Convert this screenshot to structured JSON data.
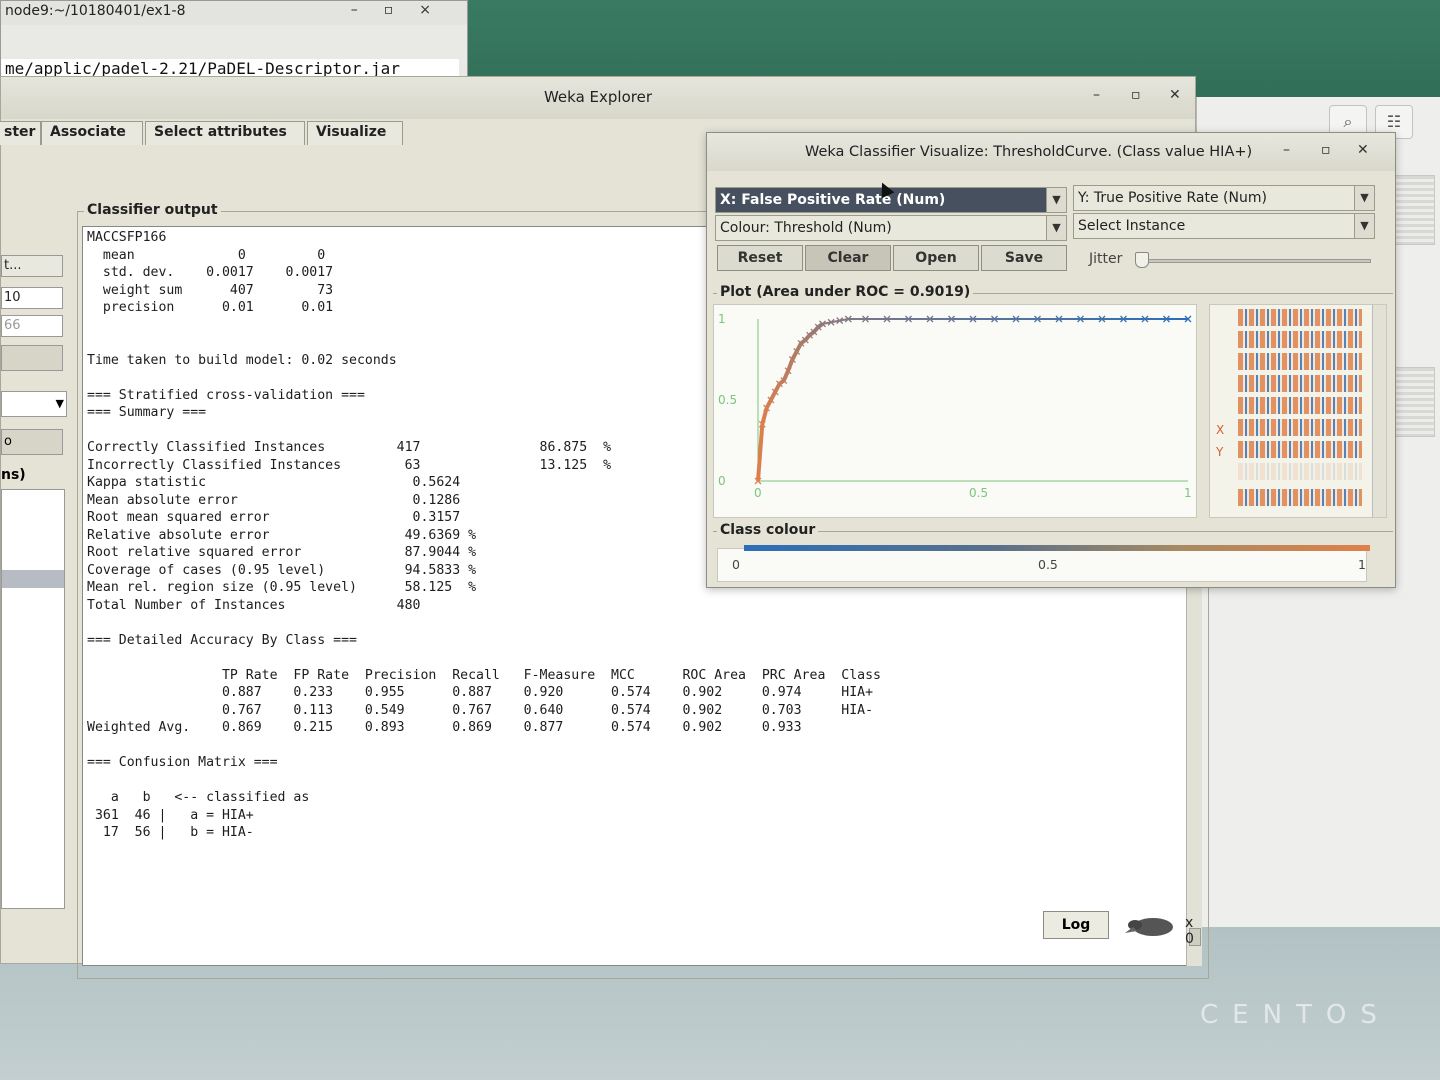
{
  "terminal": {
    "title": "node9:~/10180401/ex1-8",
    "line": "me/applic/padel-2.21/PaDEL-Descriptor.jar"
  },
  "explorer": {
    "title": "Weka Explorer",
    "tabs": [
      "ster",
      "Associate",
      "Select attributes",
      "Visualize"
    ],
    "left": {
      "field1": "t...",
      "field2": "10",
      "field3": "66",
      "label": "ns)",
      "btn": "o"
    },
    "output_label": "Classifier output",
    "output_lines": [
      "MACCSFP166",
      "  mean             0         0",
      "  std. dev.    0.0017    0.0017",
      "  weight sum      407        73",
      "  precision      0.01      0.01",
      "",
      "",
      "Time taken to build model: 0.02 seconds",
      "",
      "=== Stratified cross-validation ===",
      "=== Summary ===",
      "",
      "Correctly Classified Instances         417               86.875  %",
      "Incorrectly Classified Instances        63               13.125  %",
      "Kappa statistic                          0.5624",
      "Mean absolute error                      0.1286",
      "Root mean squared error                  0.3157",
      "Relative absolute error                 49.6369 %",
      "Root relative squared error             87.9044 %",
      "Coverage of cases (0.95 level)          94.5833 %",
      "Mean rel. region size (0.95 level)      58.125  %",
      "Total Number of Instances              480",
      "",
      "=== Detailed Accuracy By Class ===",
      "",
      "                 TP Rate  FP Rate  Precision  Recall   F-Measure  MCC      ROC Area  PRC Area  Class",
      "                 0.887    0.233    0.955      0.887    0.920      0.574    0.902     0.974     HIA+",
      "                 0.767    0.113    0.549      0.767    0.640      0.574    0.902     0.703     HIA-",
      "Weighted Avg.    0.869    0.215    0.893      0.869    0.877      0.574    0.902     0.933",
      "",
      "=== Confusion Matrix ===",
      "",
      "   a   b   <-- classified as",
      " 361  46 |   a = HIA+",
      "  17  56 |   b = HIA-"
    ],
    "log_label": "Log",
    "x_count": "x 0"
  },
  "viz": {
    "title": "Weka Classifier Visualize: ThresholdCurve. (Class value HIA+)",
    "x_combo": "X: False Positive Rate (Num)",
    "y_combo": "Y: True Positive Rate (Num)",
    "colour_combo": "Colour: Threshold (Num)",
    "select_combo": "Select Instance",
    "buttons": {
      "reset": "Reset",
      "clear": "Clear",
      "open": "Open",
      "save": "Save"
    },
    "jitter_label": "Jitter",
    "plot_label": "Plot (Area under ROC = 0.9019)",
    "class_colour_label": "Class colour",
    "colour_ticks": [
      "0",
      "0.5",
      "1"
    ],
    "attr_x": "X",
    "attr_y": "Y"
  },
  "chart_data": {
    "type": "scatter",
    "xlim": [
      0,
      1
    ],
    "ylim": [
      0,
      1
    ],
    "xticks": [
      "0",
      "0.5",
      "1"
    ],
    "yticks": [
      "0",
      "0.5",
      "1"
    ],
    "x": [
      0.0,
      0.01,
      0.02,
      0.03,
      0.04,
      0.05,
      0.06,
      0.07,
      0.08,
      0.09,
      0.1,
      0.11,
      0.12,
      0.13,
      0.14,
      0.15,
      0.17,
      0.19,
      0.21,
      0.25,
      0.3,
      0.35,
      0.4,
      0.45,
      0.5,
      0.55,
      0.6,
      0.65,
      0.7,
      0.75,
      0.8,
      0.85,
      0.9,
      0.95,
      1.0
    ],
    "y": [
      0.0,
      0.35,
      0.45,
      0.5,
      0.55,
      0.6,
      0.62,
      0.68,
      0.75,
      0.8,
      0.85,
      0.87,
      0.9,
      0.92,
      0.95,
      0.97,
      0.98,
      0.99,
      1.0,
      1.0,
      1.0,
      1.0,
      1.0,
      1.0,
      1.0,
      1.0,
      1.0,
      1.0,
      1.0,
      1.0,
      1.0,
      1.0,
      1.0,
      1.0,
      1.0
    ],
    "colour_by": "Threshold",
    "colour_scale": [
      "#2c6fb8",
      "#e0804a"
    ]
  }
}
